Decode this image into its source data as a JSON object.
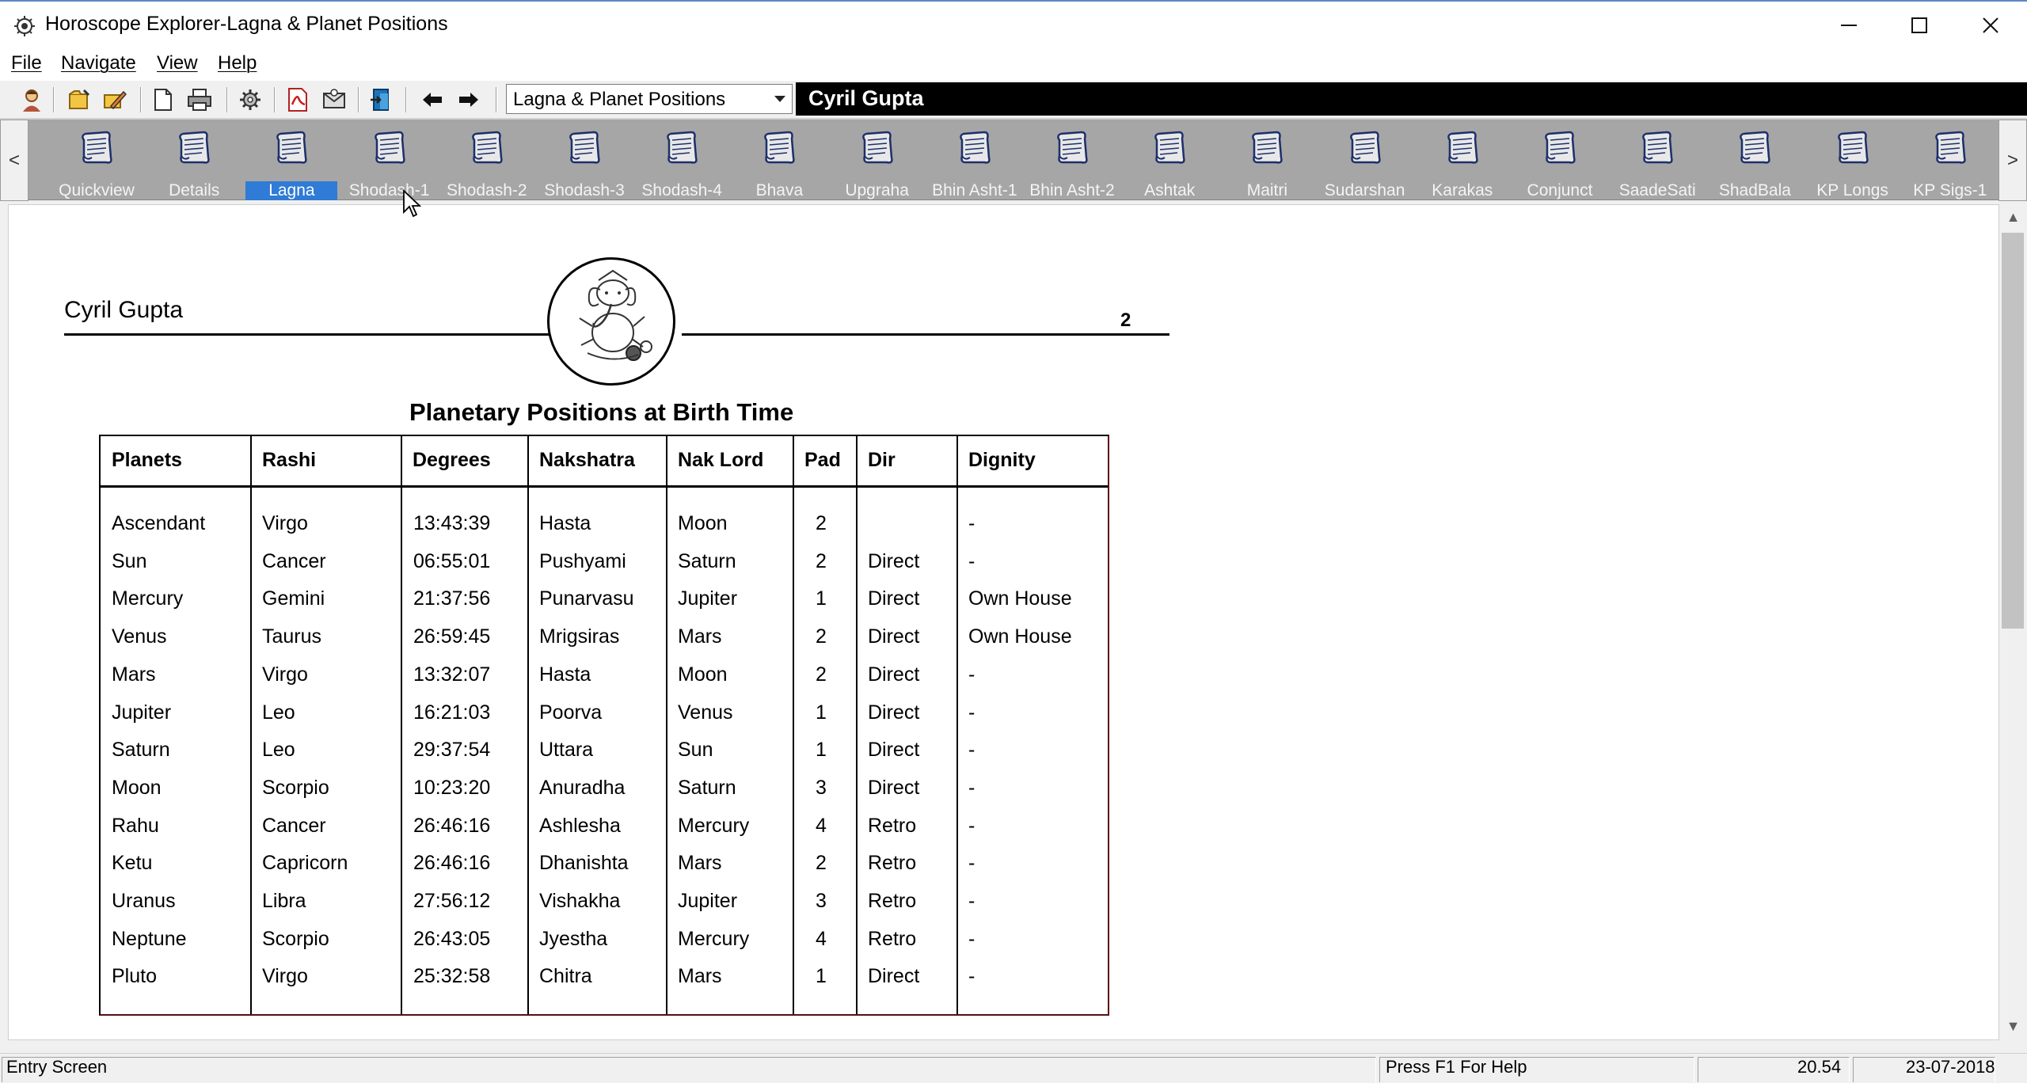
{
  "window": {
    "title": "Horoscope Explorer-Lagna & Planet Positions"
  },
  "menu": [
    "File",
    "Navigate",
    "View",
    "Help"
  ],
  "toolbar": {
    "page_select": "Lagna & Planet Positions",
    "person_name": "Cyril Gupta"
  },
  "strip": {
    "items": [
      "Quickview",
      "Details",
      "Lagna",
      "Shodash-1",
      "Shodash-2",
      "Shodash-3",
      "Shodash-4",
      "Bhava",
      "Upgraha",
      "Bhin Asht-1",
      "Bhin Asht-2",
      "Ashtak",
      "Maitri",
      "Sudarshan",
      "Karakas",
      "Conjunct",
      "SaadeSati",
      "ShadBala",
      "KP Longs",
      "KP Sigs-1"
    ],
    "active": "Lagna"
  },
  "report": {
    "name": "Cyril Gupta",
    "page_number": "2",
    "heading": "Planetary Positions at Birth Time",
    "columns": [
      "Planets",
      "Rashi",
      "Degrees",
      "Nakshatra",
      "Nak Lord",
      "Pad",
      "Dir",
      "Dignity"
    ],
    "rows": [
      [
        "Ascendant",
        "Virgo",
        "13:43:39",
        "Hasta",
        "Moon",
        "2",
        "",
        "-"
      ],
      [
        "Sun",
        "Cancer",
        "06:55:01",
        "Pushyami",
        "Saturn",
        "2",
        "Direct",
        "-"
      ],
      [
        "Mercury",
        "Gemini",
        "21:37:56",
        "Punarvasu",
        "Jupiter",
        "1",
        "Direct",
        "Own House"
      ],
      [
        "Venus",
        "Taurus",
        "26:59:45",
        "Mrigsiras",
        "Mars",
        "2",
        "Direct",
        "Own House"
      ],
      [
        "Mars",
        "Virgo",
        "13:32:07",
        "Hasta",
        "Moon",
        "2",
        "Direct",
        "-"
      ],
      [
        "Jupiter",
        "Leo",
        "16:21:03",
        "Poorva",
        "Venus",
        "1",
        "Direct",
        "-"
      ],
      [
        "Saturn",
        "Leo",
        "29:37:54",
        "Uttara",
        "Sun",
        "1",
        "Direct",
        "-"
      ],
      [
        "Moon",
        "Scorpio",
        "10:23:20",
        "Anuradha",
        "Saturn",
        "3",
        "Direct",
        "-"
      ],
      [
        "Rahu",
        "Cancer",
        "26:46:16",
        "Ashlesha",
        "Mercury",
        "4",
        "Retro",
        "-"
      ],
      [
        "Ketu",
        "Capricorn",
        "26:46:16",
        "Dhanishta",
        "Mars",
        "2",
        "Retro",
        "-"
      ],
      [
        "Uranus",
        "Libra",
        "27:56:12",
        "Vishakha",
        "Jupiter",
        "3",
        "Retro",
        "-"
      ],
      [
        "Neptune",
        "Scorpio",
        "26:43:05",
        "Jyestha",
        "Mercury",
        "4",
        "Retro",
        "-"
      ],
      [
        "Pluto",
        "Virgo",
        "25:32:58",
        "Chitra",
        "Mars",
        "1",
        "Direct",
        "-"
      ]
    ]
  },
  "status": {
    "left": "Entry Screen",
    "help": "Press F1 For Help",
    "time": "20.54",
    "date": "23-07-2018"
  },
  "colors": {
    "active_tab": "#2f7bd6",
    "strip_bg": "#a6a6a6",
    "banner_bg": "#000000"
  }
}
